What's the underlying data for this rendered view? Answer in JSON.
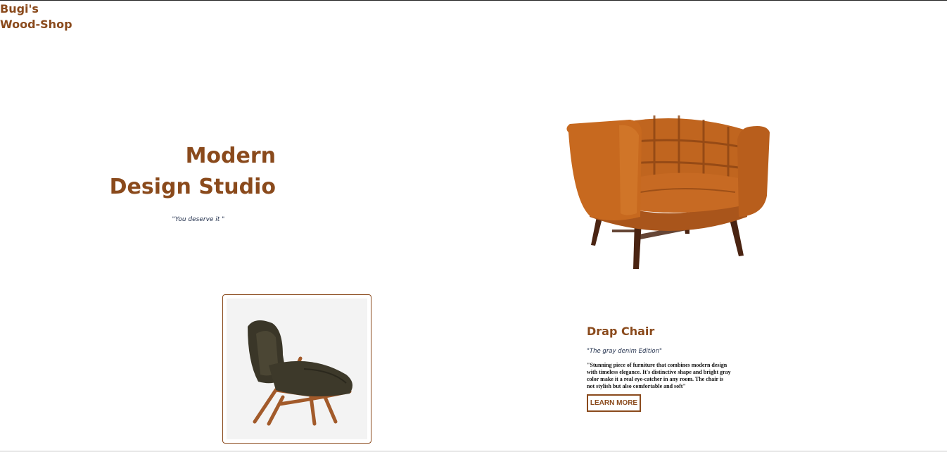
{
  "brand": {
    "line1": "Bugi's",
    "line2": "Wood-Shop"
  },
  "hero": {
    "title_line1": "Modern",
    "title_line2": "Design Studio",
    "tagline": "\"You deserve it \""
  },
  "product": {
    "name": "Drap Chair",
    "edition": "\"The gray denim Edition\"",
    "description": "\"Stunning piece of furniture that combines modern design with timeless elegance. It's distinctive shape and bright gray color make it a real eye-catcher in any room. The chair is not stylish but also comfortable and soft\"",
    "cta_label": "LEARN MORE"
  },
  "colors": {
    "accent": "#8a4a1c",
    "tagline": "#1f2d4a"
  },
  "icons": {
    "hero_image": "orange-tufted-armchair-image",
    "product_image": "dark-lounge-chair-image"
  }
}
